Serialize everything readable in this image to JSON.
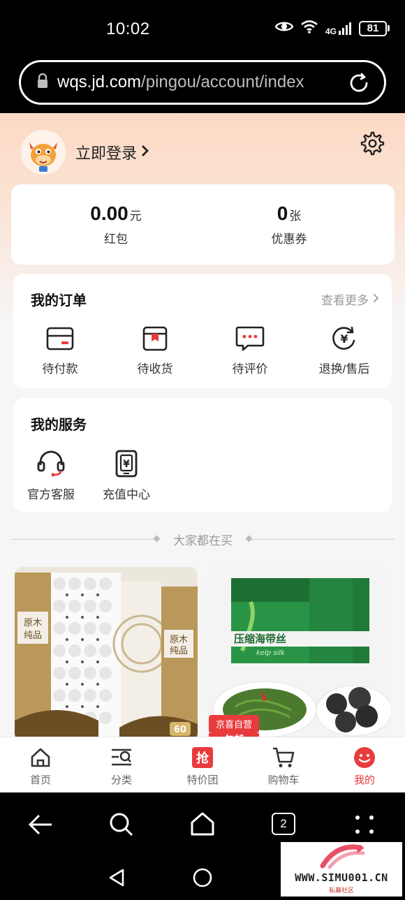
{
  "status_bar": {
    "time": "10:02",
    "network": "4G",
    "battery": "81"
  },
  "browser": {
    "url_host": "wqs.jd.com",
    "url_path": "/pingou/account/index"
  },
  "header": {
    "login_label": "立即登录"
  },
  "wallet": [
    {
      "value": "0.00",
      "unit": "元",
      "label": "红包"
    },
    {
      "value": "0",
      "unit": "张",
      "label": "优惠券"
    }
  ],
  "orders": {
    "title": "我的订单",
    "view_more": "查看更多",
    "items": [
      {
        "label": "待付款",
        "icon": "wallet-card-icon"
      },
      {
        "label": "待收货",
        "icon": "package-icon"
      },
      {
        "label": "待评价",
        "icon": "comment-icon"
      },
      {
        "label": "退换/售后",
        "icon": "refund-icon"
      }
    ]
  },
  "services": {
    "title": "我的服务",
    "items": [
      {
        "label": "官方客服",
        "icon": "headset-icon"
      },
      {
        "label": "充值中心",
        "icon": "recharge-icon"
      }
    ]
  },
  "recommend": {
    "title": "大家都在买"
  },
  "products": [
    {
      "brand_text": "原木纯品",
      "badge": "60"
    },
    {
      "title_text": "压缩海带丝",
      "subtitle_text": "kelp silk",
      "badge_text": "京喜自营",
      "badge_sub": "包邮"
    }
  ],
  "bottom_nav": [
    {
      "label": "首页",
      "icon": "home-icon"
    },
    {
      "label": "分类",
      "icon": "category-icon"
    },
    {
      "label": "特价团",
      "icon": "grab-deal-icon",
      "icon_text": "抢"
    },
    {
      "label": "购物车",
      "icon": "cart-icon"
    },
    {
      "label": "我的",
      "icon": "smiley-icon",
      "active": true
    }
  ],
  "system_nav": {
    "tab_count": "2"
  },
  "watermark": {
    "text": "WWW.SIMU001.CN",
    "sub": "私募社区"
  },
  "colors": {
    "accent": "#e93b3d",
    "header_gradient": "#fcd9c4",
    "page_bg": "#f6f6f6"
  }
}
